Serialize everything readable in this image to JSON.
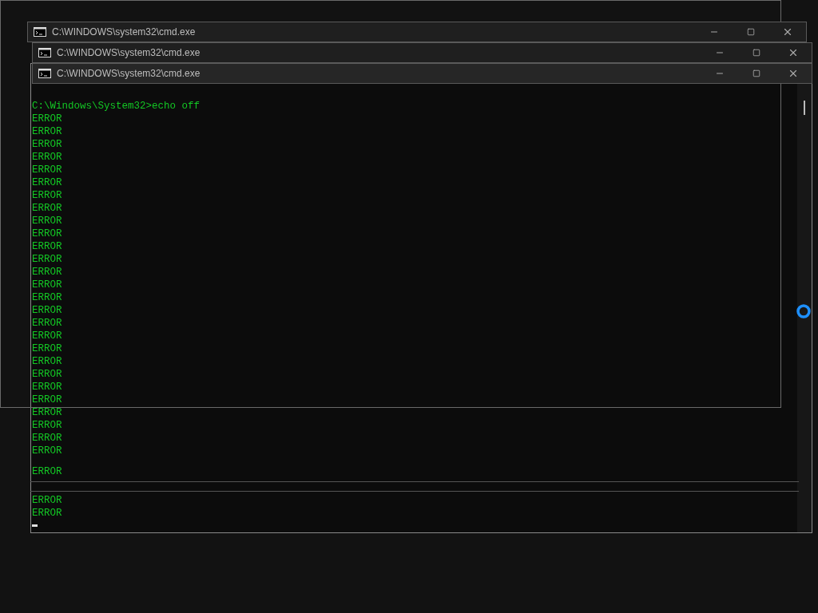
{
  "windows": [
    {
      "title": "C:\\WINDOWS\\system32\\cmd.exe"
    },
    {
      "title": "C:\\WINDOWS\\system32\\cmd.exe"
    },
    {
      "title": "C:\\WINDOWS\\system32\\cmd.exe"
    }
  ],
  "console": {
    "lines": [
      "C:\\Windows\\System32>echo off",
      "ERROR",
      "ERROR",
      "ERROR",
      "ERROR",
      "ERROR",
      "ERROR",
      "ERROR",
      "ERROR",
      "ERROR",
      "ERROR",
      "ERROR",
      "ERROR",
      "ERROR",
      "ERROR",
      "ERROR",
      "ERROR",
      "ERROR",
      "ERROR",
      "ERROR",
      "ERROR",
      "ERROR",
      "ERROR",
      "ERROR",
      "ERROR",
      "ERROR",
      "ERROR",
      "ERROR"
    ],
    "tail_lines": [
      "ERROR",
      "ERROR",
      "ERROR"
    ]
  }
}
